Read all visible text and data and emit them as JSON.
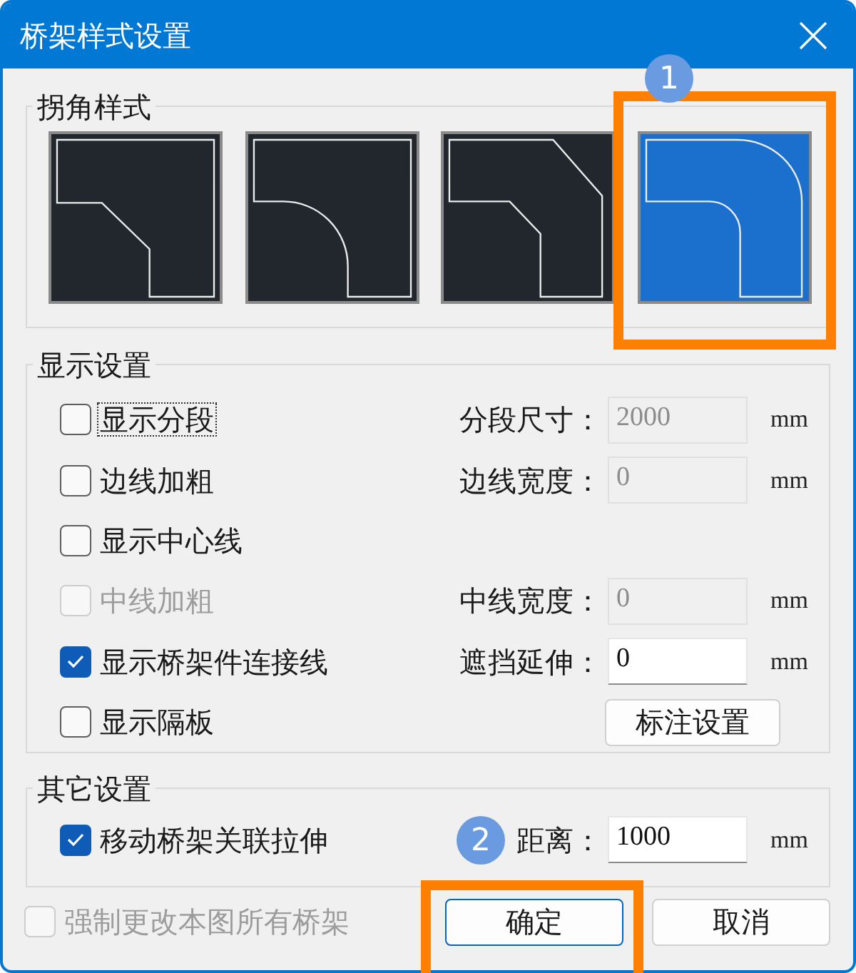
{
  "window": {
    "title": "桥架样式设置"
  },
  "corner_style": {
    "title": "拐角样式",
    "options": [
      {
        "kind": "bevel",
        "selected": false
      },
      {
        "kind": "round",
        "selected": false
      },
      {
        "kind": "bevelboth",
        "selected": false
      },
      {
        "kind": "roundboth",
        "selected": true
      }
    ]
  },
  "display_settings": {
    "title": "显示设置",
    "rows": [
      {
        "checkbox": {
          "label": "显示分段",
          "checked": false,
          "disabled": false,
          "focused": true
        },
        "field": {
          "label": "分段尺寸：",
          "value": "2000",
          "unit": "mm",
          "disabled": true
        }
      },
      {
        "checkbox": {
          "label": "边线加粗",
          "checked": false,
          "disabled": false,
          "focused": false
        },
        "field": {
          "label": "边线宽度：",
          "value": "0",
          "unit": "mm",
          "disabled": true
        }
      },
      {
        "checkbox": {
          "label": "显示中心线",
          "checked": false,
          "disabled": false,
          "focused": false
        }
      },
      {
        "checkbox": {
          "label": "中线加粗",
          "checked": false,
          "disabled": true,
          "focused": false
        },
        "field": {
          "label": "中线宽度：",
          "value": "0",
          "unit": "mm",
          "disabled": true
        }
      },
      {
        "checkbox": {
          "label": "显示桥架件连接线",
          "checked": true,
          "disabled": false,
          "focused": false
        },
        "field": {
          "label": "遮挡延伸：",
          "value": "0",
          "unit": "mm",
          "disabled": false
        }
      },
      {
        "checkbox": {
          "label": "显示隔板",
          "checked": false,
          "disabled": false,
          "focused": false
        },
        "button": {
          "label": "标注设置"
        }
      }
    ]
  },
  "other_settings": {
    "title": "其它设置",
    "rows": [
      {
        "checkbox": {
          "label": "移动桥架关联拉伸",
          "checked": true,
          "disabled": false,
          "focused": false
        },
        "field": {
          "label": "距离：",
          "value": "1000",
          "unit": "mm",
          "disabled": false
        }
      }
    ]
  },
  "footer": {
    "checkbox": {
      "label": "强制更改本图所有桥架",
      "checked": false,
      "disabled": true,
      "focused": false
    },
    "buttons": [
      {
        "label": "确定",
        "default": true
      },
      {
        "label": "取消",
        "default": false
      }
    ]
  },
  "annotations": [
    {
      "number": "1"
    },
    {
      "number": "2"
    }
  ]
}
